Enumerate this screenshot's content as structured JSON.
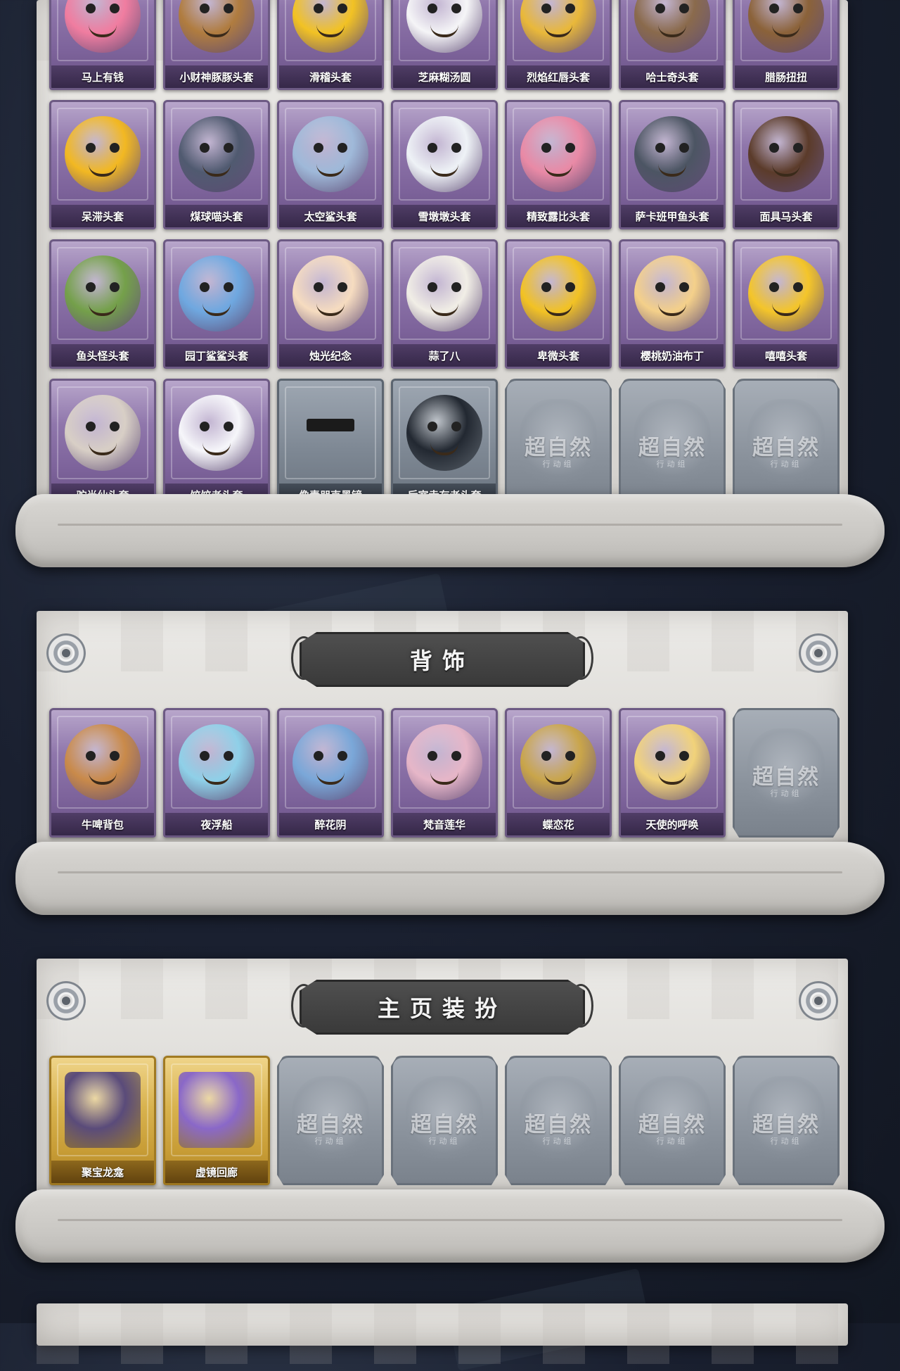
{
  "watermark": {
    "main": "超自然",
    "sub": "行动组"
  },
  "sections": [
    {
      "id": "headwear",
      "cards": [
        {
          "label": "马上有钱",
          "style": "purple",
          "art_color": "#f07da0",
          "art_shape": "circle"
        },
        {
          "label": "小财神豚豚头套",
          "style": "purple",
          "art_color": "#b07c3f",
          "art_shape": "circle"
        },
        {
          "label": "滑稽头套",
          "style": "purple",
          "art_color": "#f2c224",
          "art_shape": "circle"
        },
        {
          "label": "芝麻糊汤圆",
          "style": "purple",
          "art_color": "#f5f5f7",
          "art_shape": "circle"
        },
        {
          "label": "烈焰红唇头套",
          "style": "purple",
          "art_color": "#e9b83a",
          "art_shape": "circle"
        },
        {
          "label": "哈士奇头套",
          "style": "purple",
          "art_color": "#8a6a4c",
          "art_shape": "circle"
        },
        {
          "label": "腊肠扭扭",
          "style": "purple",
          "art_color": "#8b6239",
          "art_shape": "circle"
        },
        {
          "label": "呆滞头套",
          "style": "purple",
          "art_color": "#f2b822",
          "art_shape": "circle"
        },
        {
          "label": "煤球喵头套",
          "style": "purple",
          "art_color": "#505a70",
          "art_shape": "circle"
        },
        {
          "label": "太空鲨头套",
          "style": "purple",
          "art_color": "#9fb9d9",
          "art_shape": "circle"
        },
        {
          "label": "雪墩墩头套",
          "style": "purple",
          "art_color": "#eef2f6",
          "art_shape": "circle"
        },
        {
          "label": "精致露比头套",
          "style": "purple",
          "art_color": "#e98aa6",
          "art_shape": "circle"
        },
        {
          "label": "萨卡班甲鱼头套",
          "style": "purple",
          "art_color": "#4c5563",
          "art_shape": "circle"
        },
        {
          "label": "面具马头套",
          "style": "purple",
          "art_color": "#5b3b2a",
          "art_shape": "circle"
        },
        {
          "label": "鱼头怪头套",
          "style": "purple",
          "art_color": "#74a04a",
          "art_shape": "circle"
        },
        {
          "label": "园丁鲨鲨头套",
          "style": "purple",
          "art_color": "#6fa8e0",
          "art_shape": "circle"
        },
        {
          "label": "烛光纪念",
          "style": "purple",
          "art_color": "#f6dcc0",
          "art_shape": "circle"
        },
        {
          "label": "蒜了八",
          "style": "purple",
          "art_color": "#f1eee6",
          "art_shape": "circle"
        },
        {
          "label": "卑微头套",
          "style": "purple",
          "art_color": "#f2c224",
          "art_shape": "circle"
        },
        {
          "label": "樱桃奶油布丁",
          "style": "purple",
          "art_color": "#f4d08a",
          "art_shape": "circle"
        },
        {
          "label": "嘻嘻头套",
          "style": "purple",
          "art_color": "#f4c52a",
          "art_shape": "circle"
        },
        {
          "label": "驼半仙头套",
          "style": "purple",
          "art_color": "#d8cfc6",
          "art_shape": "circle"
        },
        {
          "label": "饺饺者头套",
          "style": "purple",
          "art_color": "#f6f6fa",
          "art_shape": "circle"
        },
        {
          "label": "像素朋克墨镜",
          "style": "grey",
          "art_color": "#1b1b1b",
          "art_shape": "glasses"
        },
        {
          "label": "后室幸存者头套",
          "style": "grey",
          "art_color": "#222831",
          "art_shape": "circle"
        },
        {
          "label": "",
          "style": "locked"
        },
        {
          "label": "",
          "style": "locked"
        },
        {
          "label": "",
          "style": "locked"
        }
      ]
    },
    {
      "id": "back",
      "title": "背饰",
      "cards": [
        {
          "label": "牛啤背包",
          "style": "purple",
          "art_color": "#c98a4a",
          "art_shape": "circle"
        },
        {
          "label": "夜浮船",
          "style": "purple",
          "art_color": "#8fd0e8",
          "art_shape": "circle"
        },
        {
          "label": "醉花阴",
          "style": "purple",
          "art_color": "#7aa7d8",
          "art_shape": "circle"
        },
        {
          "label": "梵音莲华",
          "style": "purple",
          "art_color": "#e6b6c8",
          "art_shape": "circle"
        },
        {
          "label": "蝶恋花",
          "style": "purple",
          "art_color": "#c9a54a",
          "art_shape": "circle"
        },
        {
          "label": "天使的呼唤",
          "style": "purple",
          "art_color": "#f1d27a",
          "art_shape": "circle"
        },
        {
          "label": "",
          "style": "locked"
        }
      ]
    },
    {
      "id": "homepage",
      "title": "主页装扮",
      "cards": [
        {
          "label": "聚宝龙龛",
          "style": "gold",
          "art_color": "#5a4b7a",
          "art_shape": "square"
        },
        {
          "label": "虚镜回廊",
          "style": "gold",
          "art_color": "#8a68c8",
          "art_shape": "square"
        },
        {
          "label": "",
          "style": "locked"
        },
        {
          "label": "",
          "style": "locked"
        },
        {
          "label": "",
          "style": "locked"
        },
        {
          "label": "",
          "style": "locked"
        },
        {
          "label": "",
          "style": "locked"
        }
      ]
    }
  ]
}
